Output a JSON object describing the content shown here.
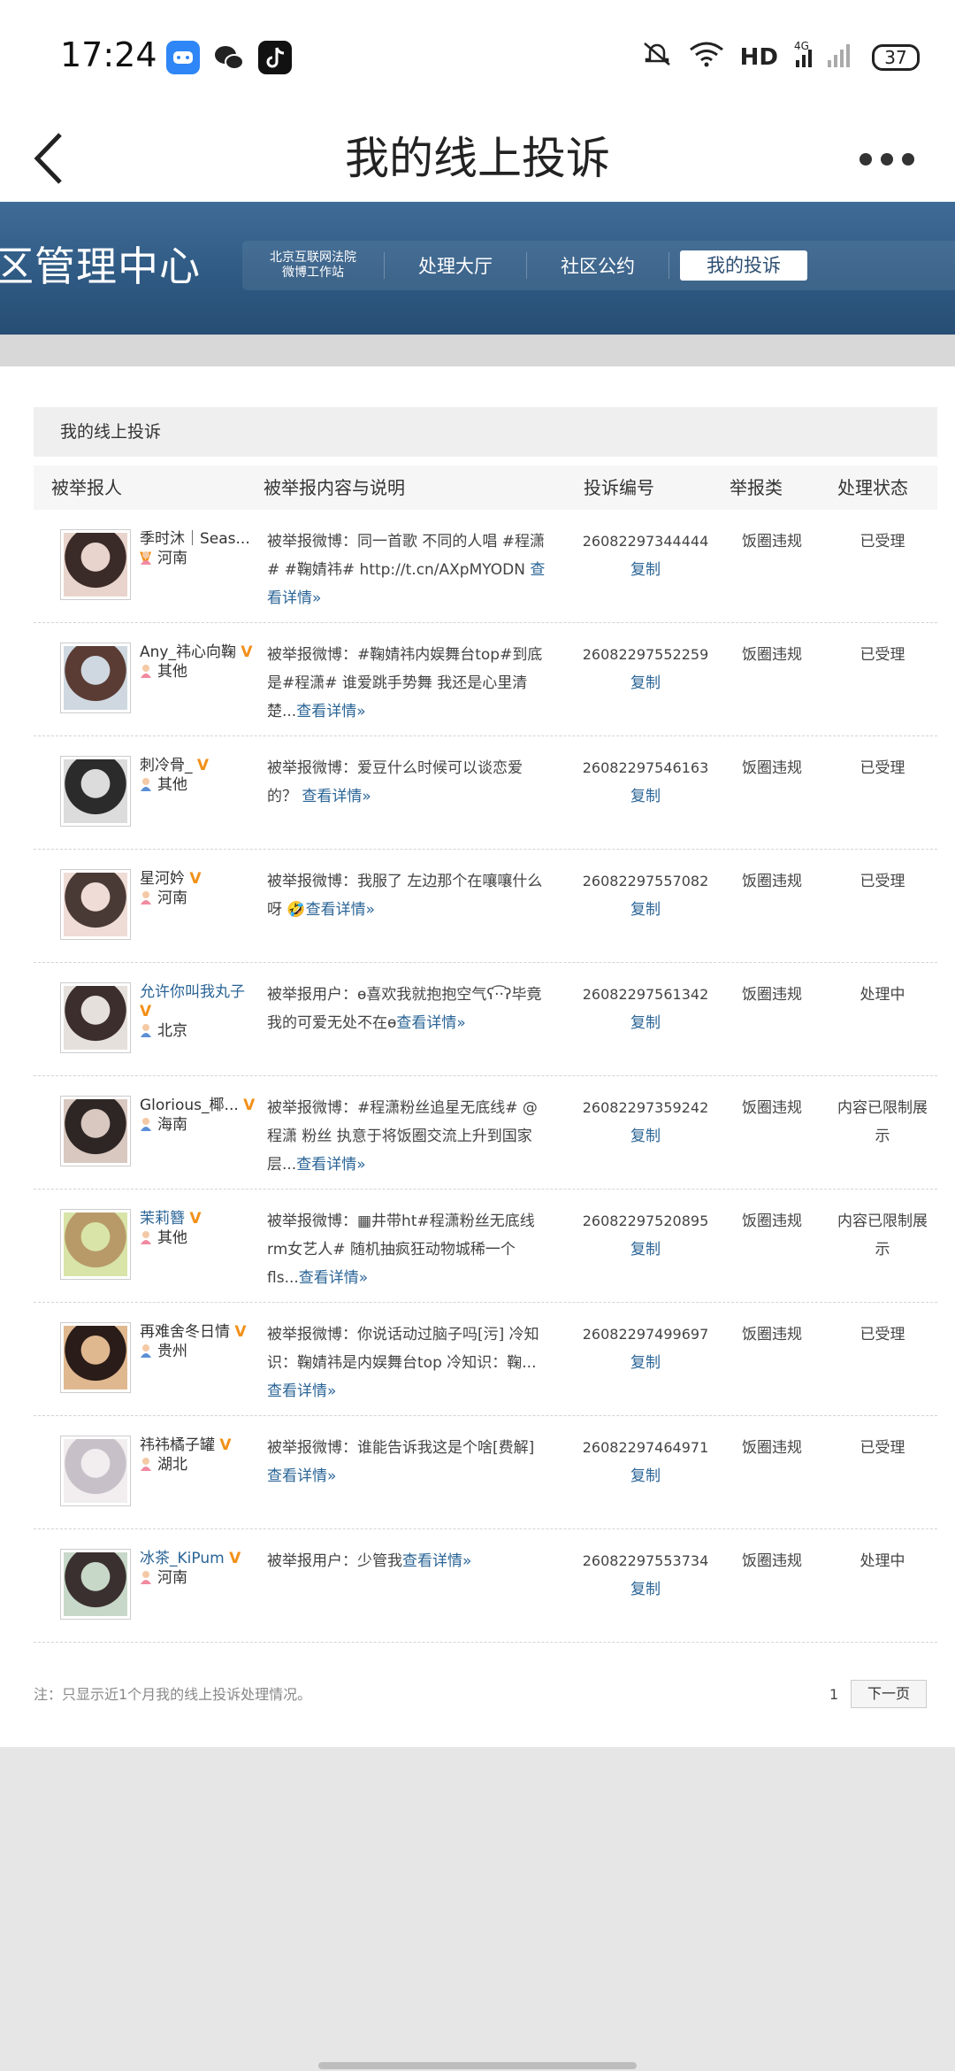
{
  "status_bar": {
    "time": "17:24",
    "apps": [
      "game-icon",
      "wechat-icon",
      "tiktok-icon"
    ],
    "network": "HD",
    "signal": "4G",
    "battery": "37"
  },
  "header": {
    "title": "我的线上投诉"
  },
  "banner": {
    "title": "区管理中心",
    "nav": {
      "court_line1": "北京互联网法院",
      "court_line2": "微博工作站",
      "hall": "处理大厅",
      "convention": "社区公约",
      "my_complaints": "我的投诉"
    }
  },
  "section": {
    "title": "我的线上投诉"
  },
  "table": {
    "headers": {
      "reported": "被举报人",
      "content": "被举报内容与说明",
      "number": "投诉编号",
      "category": "举报类",
      "status": "处理状态"
    },
    "copy_label": "复制",
    "detail_label": "查看详情»",
    "rows": [
      {
        "name": "季时沐｜Seas...",
        "location": "河南",
        "content": "被举报微博：同一首歌 不同的人唱 #程潇# #鞠婧祎# http://t.cn/AXpMYODN ",
        "number": "26082297344444",
        "category": "饭圈违规",
        "status": "已受理"
      },
      {
        "name": "Any_祎心向鞠",
        "location": "其他",
        "content": "被举报微博：#鞠婧祎内娱舞台top#到底是#程潇# 谁爱跳手势舞 我还是心里清楚...",
        "number": "26082297552259",
        "category": "饭圈违规",
        "status": "已受理"
      },
      {
        "name": "刺冷骨_",
        "location": "其他",
        "content": "被举报微博：爱豆什么时候可以谈恋爱的？ ",
        "number": "26082297546163",
        "category": "饭圈违规",
        "status": "已受理"
      },
      {
        "name": "星河妗",
        "location": "河南",
        "content": "被举报微博：我服了 左边那个在嚷嚷什么呀 🤣",
        "number": "26082297557082",
        "category": "饭圈违规",
        "status": "已受理"
      },
      {
        "name": "允许你叫我丸子",
        "location": "北京",
        "content": "被举报用户：ɵ喜欢我就抱抱空气ʕ·͡·ʔ毕竟我的可爱无处不在ɵ",
        "number": "26082297561342",
        "category": "饭圈违规",
        "status": "处理中"
      },
      {
        "name": "Glorious_椰...",
        "location": "海南",
        "content": "被举报微博：#程潇粉丝追星无底线# @程潇 粉丝 执意于将饭圈交流上升到国家层...",
        "number": "26082297359242",
        "category": "饭圈违规",
        "status": "内容已限制展示"
      },
      {
        "name": "茉莉簪",
        "location": "其他",
        "content": "被举报微博：▦井带ht#程潇粉丝无底线rm女艺人# 随机抽疯狂动物城稀一个 fls...",
        "number": "26082297520895",
        "category": "饭圈违规",
        "status": "内容已限制展示"
      },
      {
        "name": "再难舍冬日情",
        "location": "贵州",
        "content": "被举报微博：你说话动过脑子吗[污] 冷知识：鞠婧祎是内娱舞台top 冷知识：鞠...",
        "number": "26082297499697",
        "category": "饭圈违规",
        "status": "已受理"
      },
      {
        "name": "祎祎橘子罐",
        "location": "湖北",
        "content": "被举报微博：谁能告诉我这是个啥[费解]",
        "number": "26082297464971",
        "category": "饭圈违规",
        "status": "已受理"
      },
      {
        "name": "冰茶_KiPum",
        "location": "河南",
        "content": "被举报用户：少管我",
        "number": "26082297553734",
        "category": "饭圈违规",
        "status": "处理中"
      }
    ]
  },
  "footer": {
    "note": "注：只显示近1个月我的线上投诉处理情况。",
    "page": "1",
    "next": "下一页"
  },
  "colors": {
    "banner": "#2f5a83",
    "link": "#2a6496",
    "vip_badge": "#f29018"
  }
}
